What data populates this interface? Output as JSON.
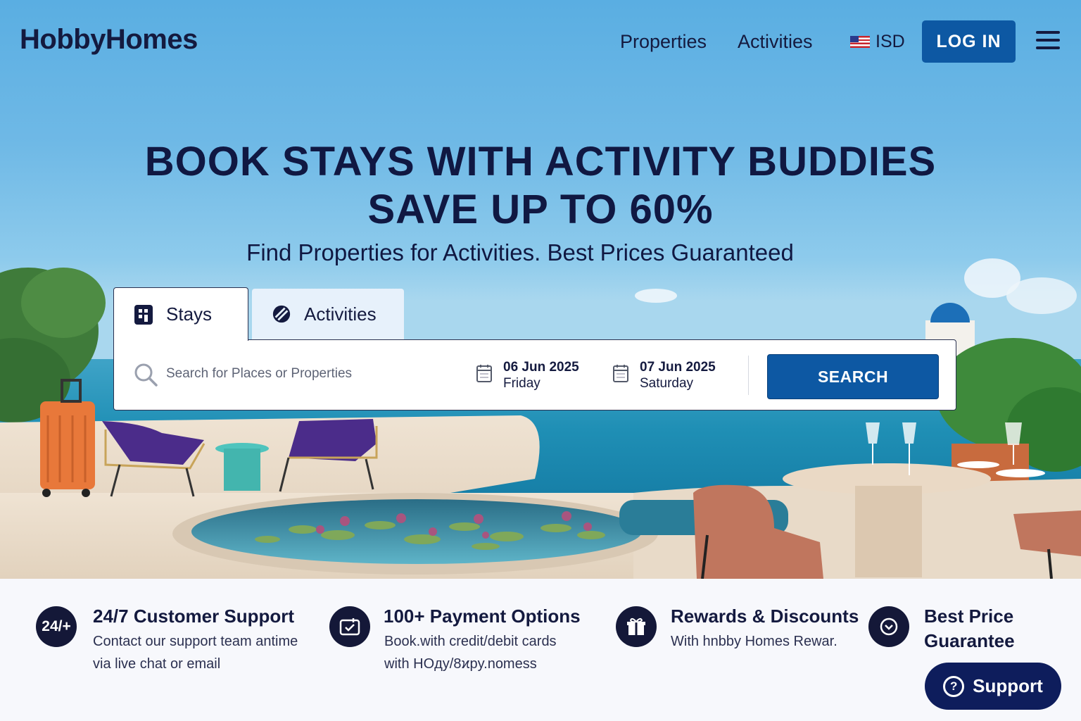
{
  "header": {
    "logo": "HobbyHomes",
    "nav": [
      "Properties",
      "Activities"
    ],
    "currency": "ISD",
    "login_label": "LOG IN"
  },
  "hero": {
    "headline_line1": "BOOK STAYS WITH ACTIVITY BUDDIES",
    "headline_line2": "SAVE UP TO 60%",
    "subheadline": "Find Properties for Activities. Best Prices Guaranteed"
  },
  "search": {
    "tabs": [
      {
        "label": "Stays",
        "icon": "building-icon",
        "active": true
      },
      {
        "label": "Activities",
        "icon": "ball-icon",
        "active": false
      }
    ],
    "placeholder": "Search for Places or Properties",
    "checkin": {
      "date": "06 Jun 2025",
      "day": "Friday"
    },
    "checkout": {
      "date": "07 Jun 2025",
      "day": "Saturday"
    },
    "button_label": "SEARCH"
  },
  "features": [
    {
      "badge": "24/+",
      "title": "24/7 Customer Support",
      "desc": [
        "Contact our support team antime",
        "via live chat or email"
      ]
    },
    {
      "badge": "card-icon",
      "title": "100+ Payment Options",
      "desc": [
        "Book.with credit/debit cards",
        "with HOдy/8ϰpy.nomess"
      ]
    },
    {
      "badge": "gift-icon",
      "title": "Rewards & Discounts",
      "desc": [
        "With hnbby Homes Rewar."
      ]
    },
    {
      "badge": "check-icon",
      "title": "Best Price Guarantee",
      "title_lines": [
        "Best Price",
        "Guarantee"
      ],
      "desc": []
    }
  ],
  "support": {
    "label": "Support"
  },
  "colors": {
    "primary": "#0d58a3",
    "navy": "#141838",
    "support_bg": "#0e1d5c",
    "headline": "#101842"
  }
}
